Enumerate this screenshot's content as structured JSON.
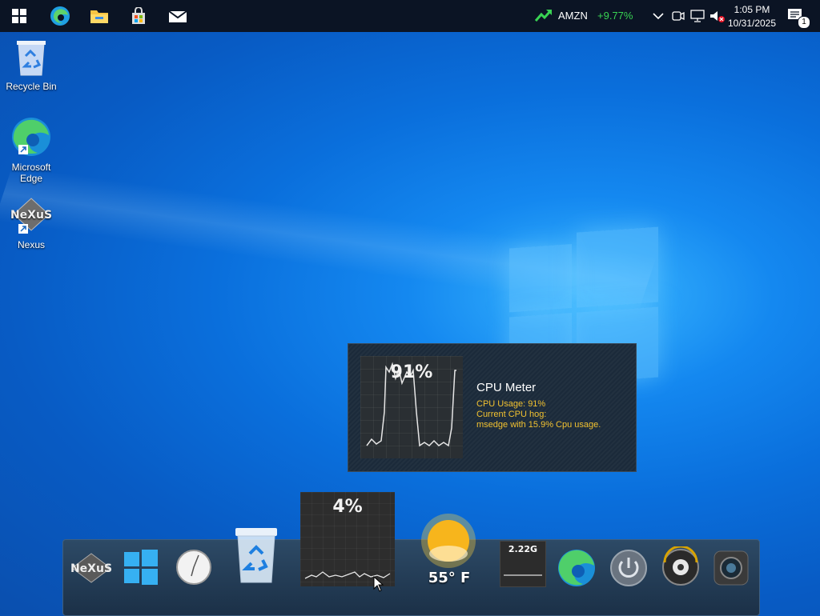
{
  "taskbar": {
    "stock_symbol": "AMZN",
    "stock_change": "+9.77%",
    "time": "1:05 PM",
    "date": "10/31/2025",
    "notification_count": "1",
    "colors": {
      "background": "#0b1424",
      "stock_up": "#39d353"
    }
  },
  "desktop": {
    "icons": [
      {
        "label": "Recycle Bin",
        "icon": "recycle-bin-icon"
      },
      {
        "label": "Microsoft Edge",
        "icon": "edge-icon"
      },
      {
        "label": "Nexus",
        "icon": "nexus-icon"
      }
    ]
  },
  "cpu_meter_popup": {
    "graph_percent": "91%",
    "title": "CPU Meter",
    "usage_line": "CPU Usage: 91%",
    "hog_label": "Current CPU hog:",
    "hog_detail": "msedge with 15.9% Cpu usage."
  },
  "dock": {
    "items": [
      "nexus-logo-icon",
      "windows-icon",
      "clock-icon",
      "recycle-bin-icon",
      "cpu-meter-widget",
      "weather-icon",
      "memory-widget",
      "edge-icon",
      "power-icon",
      "audio-speaker-icon",
      "camera-icon"
    ],
    "cpu_widget_percent": "4%",
    "weather_temp": "55° F",
    "memory_value": "2.22G"
  }
}
